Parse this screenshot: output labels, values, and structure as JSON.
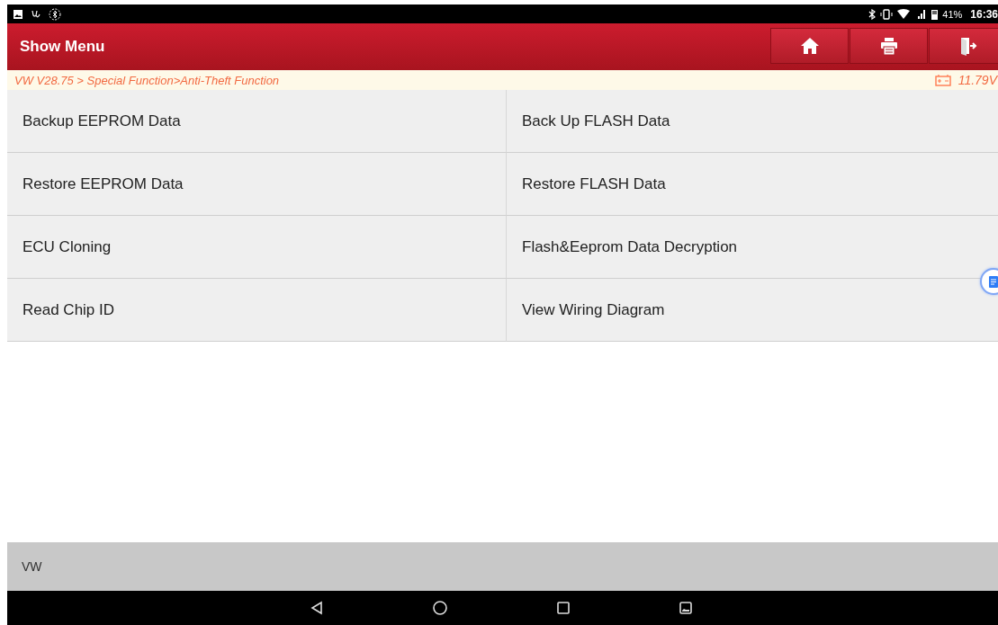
{
  "status_bar": {
    "battery": "41%",
    "time": "16:36"
  },
  "header": {
    "title": "Show Menu",
    "buttons": [
      {
        "kind": "home"
      },
      {
        "kind": "print"
      },
      {
        "kind": "exit"
      }
    ]
  },
  "breadcrumb": {
    "path": "VW V28.75 > Special Function>Anti-Theft Function",
    "voltage": "11.79V"
  },
  "menu_items": [
    {
      "label": "Backup EEPROM Data"
    },
    {
      "label": "Back Up FLASH Data"
    },
    {
      "label": "Restore EEPROM Data"
    },
    {
      "label": "Restore FLASH Data"
    },
    {
      "label": "ECU Cloning"
    },
    {
      "label": "Flash&Eeprom Data Decryption"
    },
    {
      "label": "Read Chip ID"
    },
    {
      "label": "View Wiring Diagram"
    }
  ],
  "footer": {
    "text": "VW"
  }
}
